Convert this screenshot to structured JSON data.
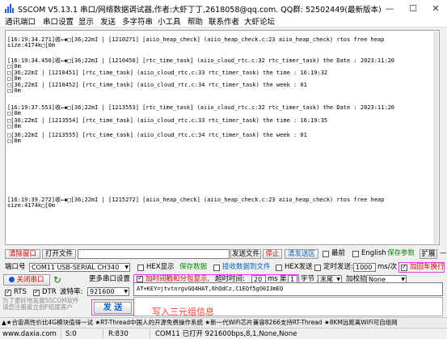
{
  "window": {
    "title": "SSCOM V5.13.1 串口/网络数据调试器,作者:大虾丁丁,2618058@qq.com. QQ群: 52502449(最新版本)",
    "controls": [
      "—",
      "☐",
      "✕"
    ]
  },
  "menu": [
    "通讯端口",
    "串口设置",
    "显示",
    "发送",
    "多字符串",
    "小工具",
    "帮助",
    "联系作者",
    "大虾论坛"
  ],
  "log_lines": [
    "[16:19:34.271]收←◆□[36;22mI | [1210271] [aiio_heap_check] (aiio_heap_check.c:23 aiio_heap_check) rtos free heap",
    "size:4174k□[0m",
    "[16:19:34.450]收←◆□[36;22mI | [1210450] [rtc_time_task] (aiio_cloud_rtc.c:32 rtc_timer_task) the Date : 2023:11:20",
    "□[0m",
    "□[36;22mI | [1210451] [rtc_time_task] (aiio_cloud_rtc.c:33 rtc_timer_task) the time : 16:19:32",
    "□[0m",
    "□[36;22mI | [1210452] [rtc_time_task] (aiio_cloud_rtc.c:34 rtc_timer_task) the week : 01",
    "□[0m",
    "[16:19:37.553]收←◆□[36;22mI | [1213553] [rtc_time_task] (aiio_cloud_rtc.c:32 rtc_timer_task) the Date : 2023:11:20",
    "□[0m",
    "□[36;22mI | [1213554] [rtc_time_task] (aiio_cloud_rtc.c:33 rtc_timer_task) the time : 16:19:35",
    "□[0m",
    "□[36;22mI | [1213555] [rtc_time_task] (aiio_cloud_rtc.c:34 rtc_timer_task) the week : 01",
    "□[0m",
    "[16:19:39.272]收←◆□[36;22mI | [1215272] [aiio_heap_check] (aiio_heap_check.c:23 aiio_heap_check) rtos free heap",
    "size:4174k□[0m"
  ],
  "toolbar": {
    "clear_window": "清除窗口",
    "open_file": "打开文件",
    "send_file": "发送文件",
    "stop": "停止",
    "clear_send": "清发送区",
    "front": "最前",
    "english": "English",
    "save_params": "保存参数",
    "expand": "扩展",
    "collapse": "—"
  },
  "port_row": {
    "port_label": "端口号",
    "port_value": "COM11 USB-SERIAL CH340",
    "hex_display": "HEX显示",
    "save_data": "保存数据",
    "recv_to_file": "接收数据到文件",
    "hex_send": "HEX发送",
    "timed_send": "定时发送:",
    "interval": "1000",
    "interval_unit": "ms/次",
    "add_crlf": "加回车换行"
  },
  "row3": {
    "close_port": "关闭串口",
    "more_settings": "更多串口设置",
    "timestamp_label": "加时间戳和分包显示,",
    "timeout_label": "超时时间:",
    "timeout_value": "20",
    "timeout_unit": "ms",
    "byte_no": "第",
    "byte_value": "1",
    "byte_label": "字节 至",
    "end_value": "末尾",
    "checksum_label": "加校验",
    "checksum_value": "None"
  },
  "row4": {
    "rts": "RTS",
    "dtr": "DTR",
    "baud_label": "波特率:",
    "baud_value": "921600"
  },
  "send_text": "AT+KEY=jtvtnrgvGQ4HAT,6hQdCz,C1EQf5gO0I3mEQ",
  "send_button": "发 送",
  "promo": "为了更好地发展SSCOM软件\n请您注册嘉立创F结尾客户",
  "annotation": "写入三元组信息",
  "ticker": "▲★合宙高性价比4G模块值得一试 ★RT-Thread中国人的开源免费操作系统 ★新一代WiFi芯片兼容8266支持RT-Thread ★8KM远距离WiFi可自组网",
  "status": {
    "website": "www.daxia.com",
    "s": "S:0",
    "r": "R:830",
    "port_status": "COM11 已打开  921600bps,8,1,None,None"
  }
}
